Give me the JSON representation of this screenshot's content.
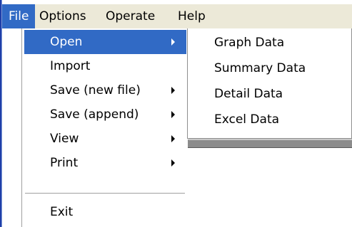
{
  "menubar": {
    "items": [
      {
        "label": "File",
        "active": true
      },
      {
        "label": "Options",
        "active": false
      },
      {
        "label": "Operate",
        "active": false
      },
      {
        "label": "Help",
        "active": false
      }
    ]
  },
  "file_menu": {
    "items": [
      {
        "label": "Open",
        "has_submenu": true,
        "highlighted": true
      },
      {
        "label": "Import",
        "has_submenu": false
      },
      {
        "label": "Save (new file)",
        "has_submenu": true
      },
      {
        "label": "Save (append)",
        "has_submenu": true
      },
      {
        "label": "View",
        "has_submenu": true
      },
      {
        "label": "Print",
        "has_submenu": true
      },
      {
        "label": "Exit",
        "has_submenu": false
      }
    ]
  },
  "open_submenu": {
    "items": [
      {
        "label": "Graph Data"
      },
      {
        "label": "Summary Data"
      },
      {
        "label": "Detail Data"
      },
      {
        "label": "Excel Data"
      }
    ]
  },
  "colors": {
    "highlight": "#316ac5",
    "menubar_bg": "#ece9d8",
    "window_frame": "#1e3ea8"
  }
}
